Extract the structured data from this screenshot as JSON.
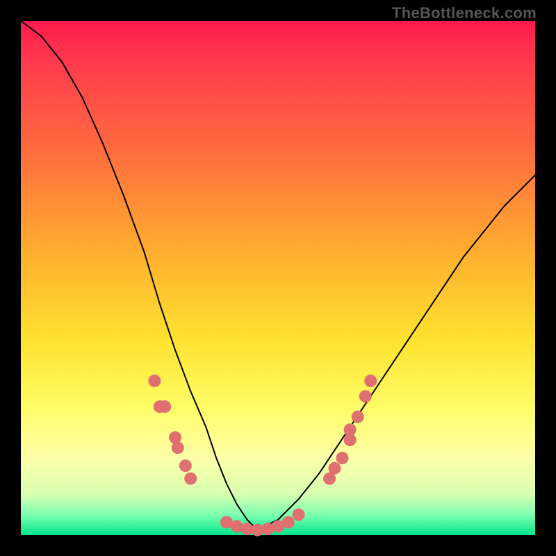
{
  "watermark": "TheBottleneck.com",
  "colors": {
    "marker_fill": "#e07070",
    "curve_stroke": "#000000",
    "frame_bg_top": "#ff1a4d",
    "frame_bg_bottom": "#00e58a",
    "page_bg": "#000000"
  },
  "chart_data": {
    "type": "line",
    "title": "",
    "xlabel": "",
    "ylabel": "",
    "xlim": [
      0,
      100
    ],
    "ylim": [
      0,
      100
    ],
    "grid": false,
    "curve_left": {
      "x": [
        0,
        4,
        8,
        12,
        16,
        20,
        24,
        27,
        30,
        33,
        36,
        38,
        40,
        42,
        44,
        46
      ],
      "y": [
        100,
        97,
        92,
        85,
        76,
        66,
        55,
        45,
        36,
        28,
        21,
        15,
        10,
        6,
        3,
        1
      ]
    },
    "curve_right": {
      "x": [
        46,
        50,
        54,
        58,
        62,
        66,
        70,
        74,
        78,
        82,
        86,
        90,
        94,
        98,
        100
      ],
      "y": [
        1,
        3,
        7,
        12,
        18,
        24,
        30,
        36,
        42,
        48,
        54,
        59,
        64,
        68,
        70
      ]
    },
    "markers": [
      {
        "x": 26,
        "y": 30
      },
      {
        "x": 27,
        "y": 25
      },
      {
        "x": 28,
        "y": 25
      },
      {
        "x": 30,
        "y": 19
      },
      {
        "x": 30.5,
        "y": 17
      },
      {
        "x": 32,
        "y": 13.5
      },
      {
        "x": 33,
        "y": 11
      },
      {
        "x": 40,
        "y": 2.5
      },
      {
        "x": 42,
        "y": 1.7
      },
      {
        "x": 44,
        "y": 1.2
      },
      {
        "x": 46,
        "y": 1
      },
      {
        "x": 48,
        "y": 1.2
      },
      {
        "x": 50,
        "y": 1.7
      },
      {
        "x": 52,
        "y": 2.5
      },
      {
        "x": 54,
        "y": 4
      },
      {
        "x": 60,
        "y": 11
      },
      {
        "x": 61,
        "y": 13
      },
      {
        "x": 62.5,
        "y": 15
      },
      {
        "x": 64,
        "y": 18.5
      },
      {
        "x": 64,
        "y": 20.5
      },
      {
        "x": 65.5,
        "y": 23
      },
      {
        "x": 67,
        "y": 27
      },
      {
        "x": 68,
        "y": 30
      }
    ]
  }
}
